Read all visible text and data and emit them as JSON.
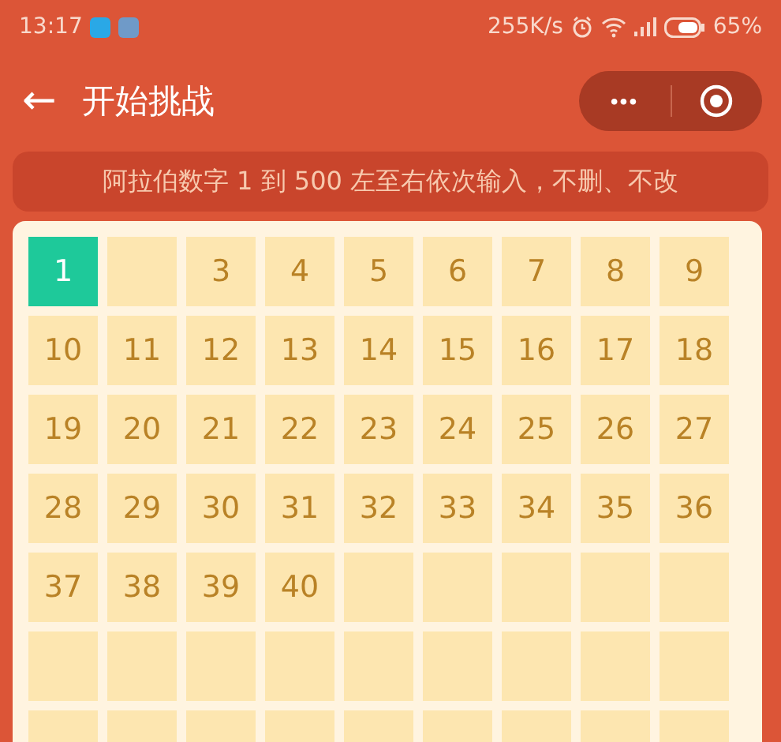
{
  "status_bar": {
    "time": "13:17",
    "speed": "255K/s",
    "battery": "65%"
  },
  "nav": {
    "back": "←",
    "title": "开始挑战",
    "more": "•••"
  },
  "notice": "阿拉伯数字 1 到 500 左至右依次输入，不删、不改",
  "cells": [
    {
      "label": "1",
      "selected": true
    },
    {
      "selected": false
    },
    {
      "label": "3",
      "selected": false
    },
    {
      "label": "4",
      "selected": false
    },
    {
      "label": "5",
      "selected": false
    },
    {
      "label": "6",
      "selected": false
    },
    {
      "label": "7",
      "selected": false
    },
    {
      "label": "8",
      "selected": false
    },
    {
      "label": "9",
      "selected": false
    },
    {
      "label": "10",
      "selected": false
    },
    {
      "label": "11",
      "selected": false
    },
    {
      "label": "12",
      "selected": false
    },
    {
      "label": "13",
      "selected": false
    },
    {
      "label": "14",
      "selected": false
    },
    {
      "label": "15",
      "selected": false
    },
    {
      "label": "16",
      "selected": false
    },
    {
      "label": "17",
      "selected": false
    },
    {
      "label": "18",
      "selected": false
    },
    {
      "label": "19",
      "selected": false
    },
    {
      "label": "20",
      "selected": false
    },
    {
      "label": "21",
      "selected": false
    },
    {
      "label": "22",
      "selected": false
    },
    {
      "label": "23",
      "selected": false
    },
    {
      "label": "24",
      "selected": false
    },
    {
      "label": "25",
      "selected": false
    },
    {
      "label": "26",
      "selected": false
    },
    {
      "label": "27",
      "selected": false
    },
    {
      "label": "28",
      "selected": false
    },
    {
      "label": "29",
      "selected": false
    },
    {
      "label": "30",
      "selected": false
    },
    {
      "label": "31",
      "selected": false
    },
    {
      "label": "32",
      "selected": false
    },
    {
      "label": "33",
      "selected": false
    },
    {
      "label": "34",
      "selected": false
    },
    {
      "label": "35",
      "selected": false
    },
    {
      "label": "36",
      "selected": false
    },
    {
      "label": "37",
      "selected": false
    },
    {
      "label": "38",
      "selected": false
    },
    {
      "label": "39",
      "selected": false
    },
    {
      "label": "40",
      "selected": false
    },
    {
      "selected": false
    },
    {
      "selected": false
    },
    {
      "selected": false
    },
    {
      "selected": false
    },
    {
      "selected": false
    },
    {
      "selected": false
    },
    {
      "selected": false
    },
    {
      "selected": false
    },
    {
      "selected": false
    },
    {
      "selected": false
    },
    {
      "selected": false
    },
    {
      "selected": false
    },
    {
      "selected": false
    },
    {
      "selected": false
    },
    {
      "selected": false
    },
    {
      "selected": false
    },
    {
      "selected": false
    },
    {
      "selected": false
    },
    {
      "selected": false
    },
    {
      "selected": false
    },
    {
      "selected": false
    },
    {
      "selected": false
    },
    {
      "selected": false
    }
  ]
}
